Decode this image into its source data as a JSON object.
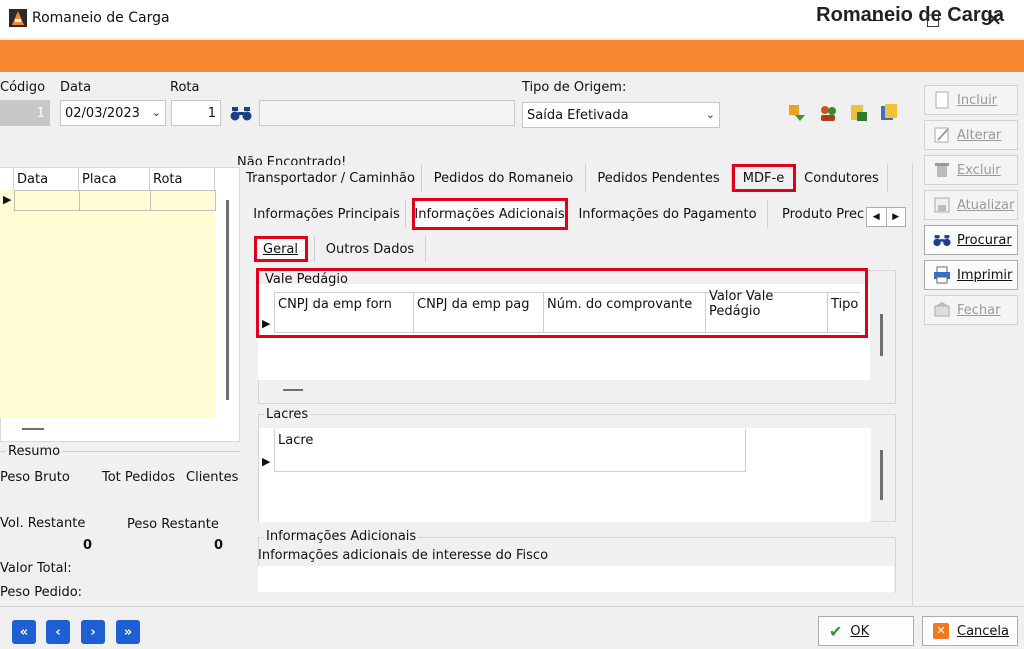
{
  "window": {
    "title": "Romaneio de Carga"
  },
  "banner": {
    "title": "Romaneio de Carga"
  },
  "header": {
    "codigo_label": "Código",
    "codigo_value": "1",
    "data_label": "Data",
    "data_value": "02/03/2023",
    "rota_label": "Rota",
    "rota_value": "1",
    "tipo_origem_label": "Tipo de Origem:",
    "tipo_origem_value": "Saída Efetivada",
    "nao_encontrado": "Não Encontrado!"
  },
  "left_grid": {
    "columns": [
      "Data",
      "Placa",
      "Rota"
    ]
  },
  "resumo": {
    "title": "Resumo",
    "peso_bruto": "Peso Bruto",
    "tot_pedidos": "Tot Pedidos",
    "clientes": "Clientes",
    "vol_restante": "Vol. Restante",
    "vol_restante_value": "0",
    "peso_restante": "Peso Restante",
    "peso_restante_value": "0",
    "valor_total": "Valor Total:",
    "peso_pedido": "Peso Pedido:"
  },
  "main_tabs": [
    "Transportador / Caminhão",
    "Pedidos do Romaneio",
    "Pedidos Pendentes",
    "MDF-e",
    "Condutores"
  ],
  "sub_tabs": [
    "Informações Principais",
    "Informações Adicionais",
    "Informações do Pagamento",
    "Produto Prec"
  ],
  "inner_tabs": [
    "Geral",
    "Outros Dados"
  ],
  "vale_pedagio": {
    "title": "Vale Pedágio",
    "columns": [
      "CNPJ da emp forn",
      "CNPJ da emp pag",
      "Núm. do comprovante",
      "Valor Vale Pedágio",
      "Tipo"
    ]
  },
  "lacres": {
    "title": "Lacres",
    "columns": [
      "Lacre"
    ]
  },
  "info_adicionais": {
    "title": "Informações Adicionais",
    "label": "Informações adicionais de interesse do Fisco"
  },
  "side_buttons": [
    "Incluir",
    "Alterar",
    "Excluir",
    "Atualizar",
    "Procurar",
    "Imprimir",
    "Fechar"
  ],
  "bottom": {
    "ok_label": "OK",
    "cancel_label": "Cancela"
  },
  "colors": {
    "banner": "#f7872f",
    "highlight": "#e0001a",
    "grid_yellow": "#fffbd2",
    "nav_blue": "#1e5fd6"
  }
}
